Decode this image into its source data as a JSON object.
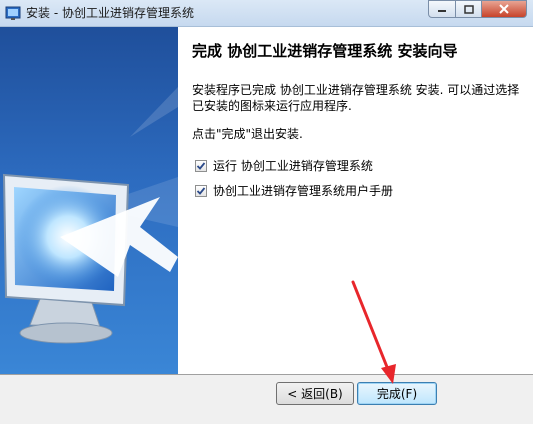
{
  "window": {
    "title": "安装 - 协创工业进销存管理系统",
    "icon": "installer-icon"
  },
  "controls": [
    "minimize-icon",
    "maximize-icon",
    "close-icon"
  ],
  "main": {
    "heading": "完成 协创工业进销存管理系统 安装向导",
    "paragraph1": "安装程序已完成 协创工业进销存管理系统 安装. 可以通过选择已安装的图标来运行应用程序.",
    "paragraph2": "点击\"完成\"退出安装.",
    "options": [
      {
        "label": "运行 协创工业进销存管理系统",
        "checked": true
      },
      {
        "label": "协创工业进销存管理系统用户手册",
        "checked": true
      }
    ]
  },
  "buttons": {
    "back": "< 返回(B)",
    "finish": "完成(F)"
  },
  "colors": {
    "sidebar_top": "#1f4f9b",
    "sidebar_bottom": "#3a86d6",
    "arrow": "#e8262b"
  }
}
